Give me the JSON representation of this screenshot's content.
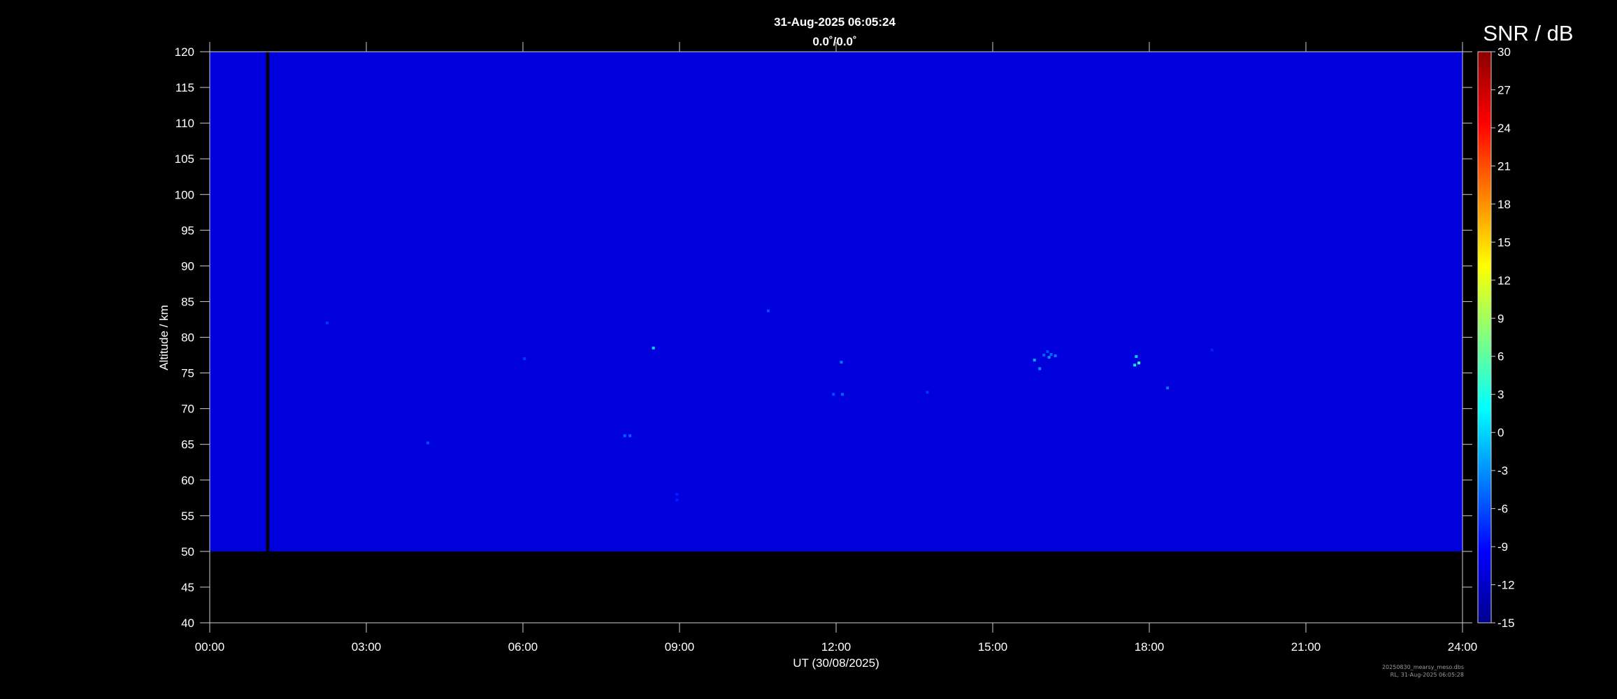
{
  "chart_data": {
    "type": "heatmap",
    "title": "31-Aug-2025 06:05:24",
    "subtitle": "0.0˚/0.0˚",
    "xlabel": "UT (30/08/2025)",
    "ylabel": "Altitude / km",
    "xlim": [
      0,
      24
    ],
    "ylim": [
      40,
      120
    ],
    "x_ticks": [
      "00:00",
      "03:00",
      "06:00",
      "09:00",
      "12:00",
      "15:00",
      "18:00",
      "21:00",
      "24:00"
    ],
    "y_ticks": [
      40,
      45,
      50,
      55,
      60,
      65,
      70,
      75,
      80,
      85,
      90,
      95,
      100,
      105,
      110,
      115,
      120
    ],
    "data_altitude_range": [
      50,
      120
    ],
    "data_gap_ut": [
      1.08,
      1.14
    ],
    "background_snr": -11,
    "colorbar": {
      "label": "SNR / dB",
      "range": [
        -15,
        30
      ],
      "ticks": [
        30,
        27,
        24,
        21,
        18,
        15,
        12,
        9,
        6,
        3,
        0,
        -3,
        -6,
        -9,
        -12,
        -15
      ],
      "colors": [
        "#00008b",
        "#0000ff",
        "#0080ff",
        "#00ffff",
        "#80ff80",
        "#ffff00",
        "#ff8000",
        "#ff0000",
        "#8b0000"
      ]
    },
    "echoes": [
      {
        "ut": 2.25,
        "alt": 82.0,
        "snr": -7
      },
      {
        "ut": 4.18,
        "alt": 65.2,
        "snr": -6
      },
      {
        "ut": 6.03,
        "alt": 77.0,
        "snr": -7
      },
      {
        "ut": 7.95,
        "alt": 66.2,
        "snr": -5
      },
      {
        "ut": 8.05,
        "alt": 66.2,
        "snr": -5
      },
      {
        "ut": 8.5,
        "alt": 78.5,
        "snr": 0
      },
      {
        "ut": 8.95,
        "alt": 58.0,
        "snr": -8
      },
      {
        "ut": 8.95,
        "alt": 57.2,
        "snr": -8
      },
      {
        "ut": 10.7,
        "alt": 83.7,
        "snr": -6
      },
      {
        "ut": 11.95,
        "alt": 72.0,
        "snr": -6
      },
      {
        "ut": 12.12,
        "alt": 72.0,
        "snr": -5
      },
      {
        "ut": 12.1,
        "alt": 76.5,
        "snr": -4
      },
      {
        "ut": 13.75,
        "alt": 72.3,
        "snr": -7
      },
      {
        "ut": 15.8,
        "alt": 76.8,
        "snr": -2
      },
      {
        "ut": 15.9,
        "alt": 75.6,
        "snr": -3
      },
      {
        "ut": 15.98,
        "alt": 77.5,
        "snr": -5
      },
      {
        "ut": 16.05,
        "alt": 78.0,
        "snr": -6
      },
      {
        "ut": 16.12,
        "alt": 77.6,
        "snr": -5
      },
      {
        "ut": 16.2,
        "alt": 77.4,
        "snr": -4
      },
      {
        "ut": 16.08,
        "alt": 77.2,
        "snr": -3
      },
      {
        "ut": 17.75,
        "alt": 77.3,
        "snr": 0
      },
      {
        "ut": 17.8,
        "alt": 76.4,
        "snr": 4
      },
      {
        "ut": 17.72,
        "alt": 76.1,
        "snr": 1
      },
      {
        "ut": 18.35,
        "alt": 72.9,
        "snr": -4
      },
      {
        "ut": 19.2,
        "alt": 78.2,
        "snr": -8
      }
    ]
  },
  "footer": {
    "file_name": "20250830_mearsy_meso.dbs",
    "stamp": "RL, 31-Aug-2025 06:05:28"
  }
}
